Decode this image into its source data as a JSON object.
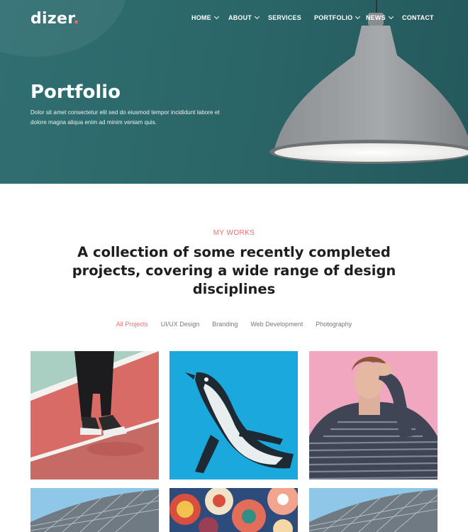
{
  "brand": {
    "name": "dizer",
    "dot": "."
  },
  "nav": {
    "items": [
      {
        "label": "HOME"
      },
      {
        "label": "ABOUT"
      },
      {
        "label": "SERVICES"
      },
      {
        "label": "PORTFOLIO"
      },
      {
        "label": "NEWS"
      },
      {
        "label": "CONTACT"
      }
    ]
  },
  "hero": {
    "title": "Portfolio",
    "subtitle": "Dolor sit amet consectetur elit sed do eiusmod tempor incididunt labore et dolore magna aliqua enim ad minim veniam quis."
  },
  "works": {
    "eyebrow": "MY WORKS",
    "headline": "A collection of some recently completed projects, covering a wide range of design disciplines",
    "filters": [
      {
        "label": "All Projects",
        "active": true
      },
      {
        "label": "UI/UX Design",
        "active": false
      },
      {
        "label": "Branding",
        "active": false
      },
      {
        "label": "Web Development",
        "active": false
      },
      {
        "label": "Photography",
        "active": false
      }
    ]
  },
  "colors": {
    "accent": "#f06a6a",
    "hero_bg": "#2b6769"
  }
}
